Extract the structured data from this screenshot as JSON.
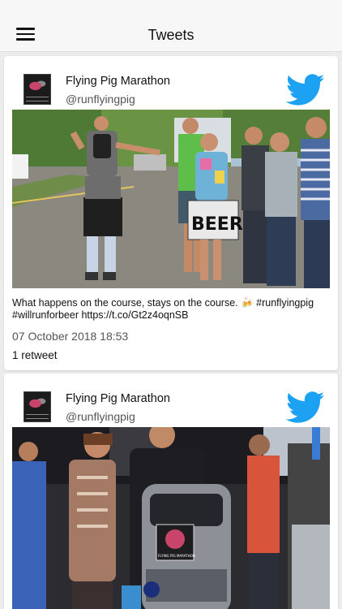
{
  "header": {
    "title": "Tweets",
    "menu_icon": "hamburger-menu-icon"
  },
  "tweets": [
    {
      "author_name": "Flying Pig Marathon",
      "author_handle": "@runflyingpig",
      "text": "What happens on the course, stays on the course. 🍻 #runflyingpig #willrunforbeer https://t.co/Gt2z4oqnSB",
      "sign_text": "BEER",
      "date": "07 October 2018 18:53",
      "retweets": "1 retweet"
    },
    {
      "author_name": "Flying Pig Marathon",
      "author_handle": "@runflyingpig",
      "bag_text": "FLYING PIG MARATHON"
    }
  ],
  "colors": {
    "twitter_blue": "#1da1f2",
    "background": "#ececec",
    "card": "#ffffff"
  }
}
